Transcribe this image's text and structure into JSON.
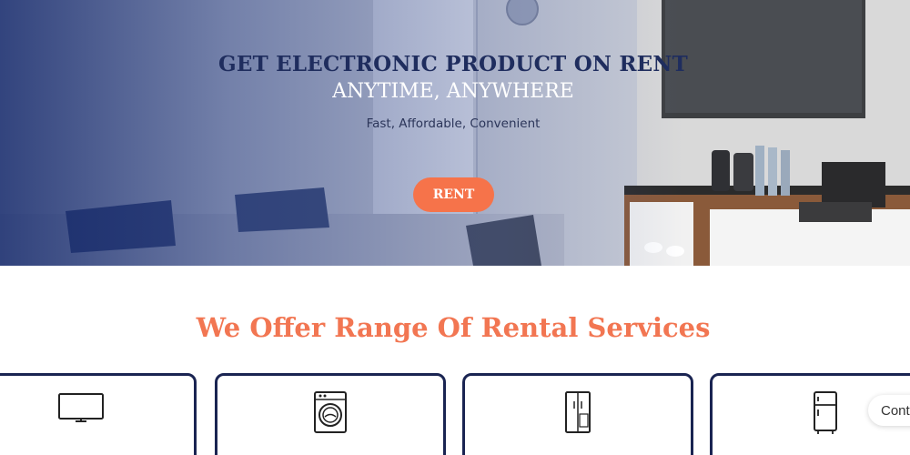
{
  "hero": {
    "title": "GET ELECTRONIC PRODUCT ON RENT",
    "subtitle": "ANYTIME, ANYWHERE",
    "tagline": "Fast, Affordable, Convenient",
    "cta_label": "RENT"
  },
  "services": {
    "heading": "We Offer Range Of Rental Services",
    "cards": [
      {
        "icon": "tv-icon"
      },
      {
        "icon": "washing-machine-icon"
      },
      {
        "icon": "double-door-fridge-icon"
      },
      {
        "icon": "refrigerator-icon"
      }
    ]
  },
  "chat": {
    "label": "Cont"
  },
  "colors": {
    "brand_navy": "#1f2d5e",
    "accent_orange": "#f6734a",
    "heading_orange": "#f27652"
  }
}
